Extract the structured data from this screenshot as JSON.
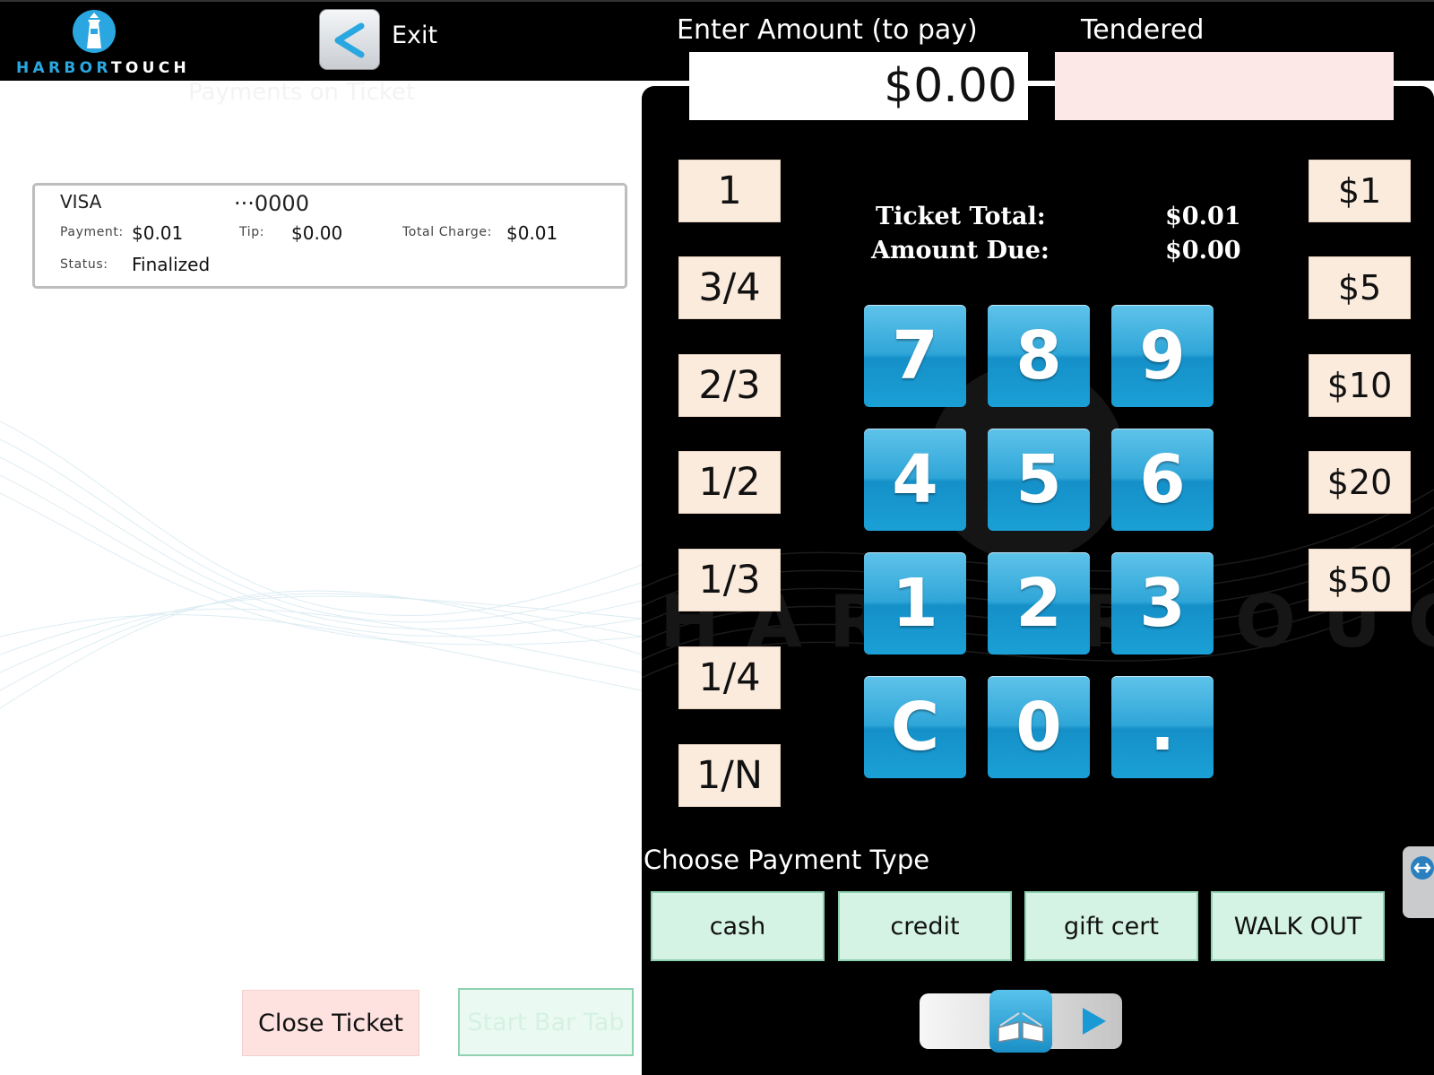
{
  "header": {
    "logo_text_blue": "HARBOR",
    "logo_text_white": "TOUCH",
    "exit_label": "Exit",
    "amount_label": "Enter Amount (to pay)",
    "tendered_label": "Tendered"
  },
  "amount": {
    "value": "$0.00",
    "tendered": ""
  },
  "left": {
    "faint_title": "Payments on Ticket"
  },
  "payment": {
    "card_type": "VISA",
    "card_number": "···0000",
    "payment_label": "Payment:",
    "payment_value": "$0.01",
    "tip_label": "Tip:",
    "tip_value": "$0.00",
    "total_label": "Total Charge:",
    "total_value": "$0.01",
    "status_label": "Status:",
    "status_value": "Finalized"
  },
  "summary": {
    "ticket_total_label": "Ticket Total:",
    "ticket_total_value": "$0.01",
    "amount_due_label": "Amount Due:",
    "amount_due_value": "$0.00"
  },
  "fractions": [
    "1",
    "3/4",
    "2/3",
    "1/2",
    "1/3",
    "1/4",
    "1/N"
  ],
  "cash_amounts": [
    "$1",
    "$5",
    "$10",
    "$20",
    "$50"
  ],
  "keypad": [
    "7",
    "8",
    "9",
    "4",
    "5",
    "6",
    "1",
    "2",
    "3",
    "C",
    "0",
    "."
  ],
  "payment_type": {
    "label": "Choose Payment Type",
    "options": [
      "cash",
      "credit",
      "gift cert",
      "WALK OUT"
    ]
  },
  "actions": {
    "close_ticket": "Close Ticket",
    "start_bar_tab": "Start Bar Tab"
  },
  "colors": {
    "keypad_blue": "#2aa7e0",
    "fraction_bg": "#fbebdd",
    "payment_type_bg": "#d5f3e5",
    "close_ticket_bg": "#fde2e0",
    "tendered_bg": "#fde8e8"
  },
  "icons": {
    "exit": "back-arrow-icon",
    "slider": "book-icon",
    "next": "play-arrow-icon"
  }
}
